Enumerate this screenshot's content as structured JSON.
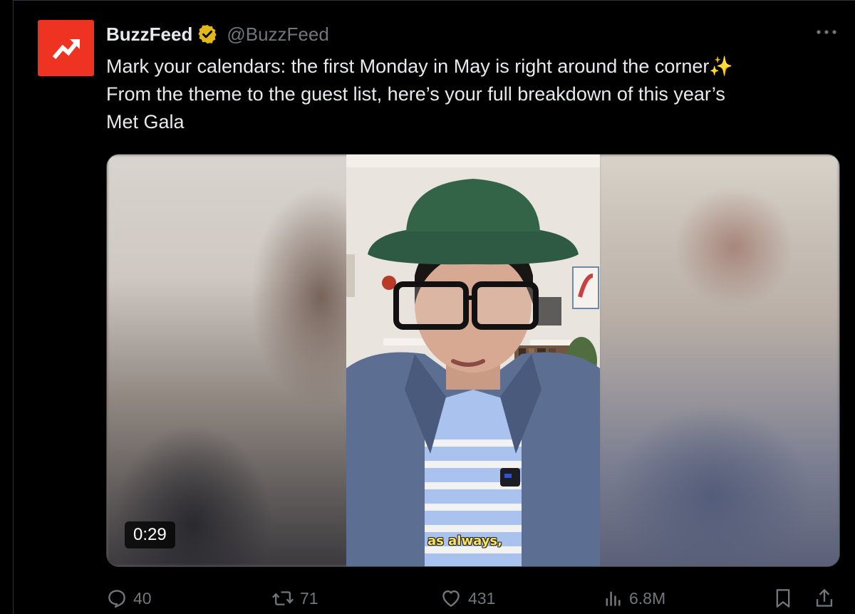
{
  "tweet": {
    "display_name": "BuzzFeed",
    "handle": "@BuzzFeed",
    "verified": true,
    "text": "Mark your calendars: the first Monday in May is right around the corner✨\nFrom the theme to the guest list, here’s your full breakdown of this year’s\nMet Gala"
  },
  "media": {
    "duration": "0:29",
    "caption": "as always,"
  },
  "actions": {
    "replies": "40",
    "reposts": "71",
    "likes": "431",
    "views": "6.8M"
  },
  "colors": {
    "brand": "#ee3322",
    "verified_badge": "#e2b719",
    "muted": "#71767b",
    "text": "#e7e9ea"
  },
  "icons": {
    "avatar": "buzzfeed-trending-arrow-icon",
    "verified": "verified-badge-icon",
    "more": "more-horizontal-icon",
    "reply": "reply-icon",
    "repost": "repost-icon",
    "like": "heart-icon",
    "views": "views-bar-chart-icon",
    "bookmark": "bookmark-icon",
    "share": "share-icon"
  }
}
